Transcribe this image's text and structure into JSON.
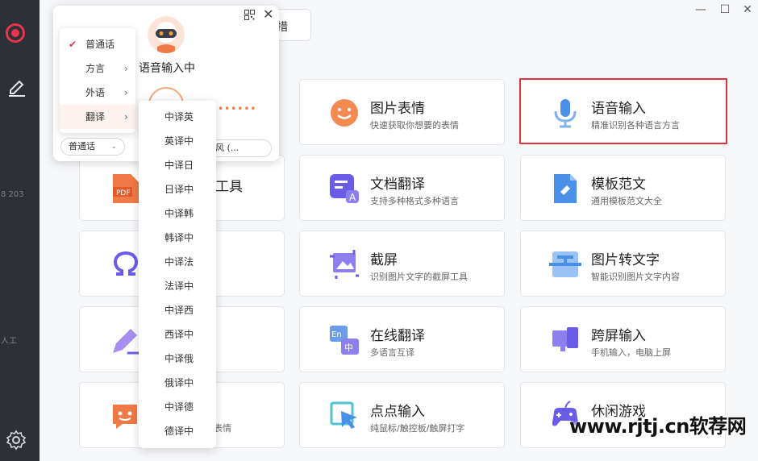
{
  "window": {
    "minimize": "—",
    "maximize": "☐",
    "close": "✕"
  },
  "rail": {
    "fragments": [
      "8 203",
      "人工"
    ]
  },
  "hidden_button": {
    "label": "措"
  },
  "cards": [
    {
      "title": "图片表情",
      "desc": "快速获取你想要的表情",
      "icon": "smile-emoji-icon"
    },
    {
      "title": "语音输入",
      "desc": "精准识别各种语言方言",
      "icon": "microphone-icon"
    },
    {
      "title": "文档翻译",
      "desc": "支持多种格式多种语言",
      "icon": "document-translate-icon"
    },
    {
      "title": "模板范文",
      "desc": "通用模板范文大全",
      "icon": "template-icon"
    },
    {
      "title": "截屏",
      "desc": "识别图片文字的截屏工具",
      "icon": "screenshot-icon"
    },
    {
      "title": "图片转文字",
      "desc": "智能识别图片文字内容",
      "icon": "image-to-text-icon"
    },
    {
      "title": "在线翻译",
      "desc": "多语言互译",
      "icon": "online-translate-icon"
    },
    {
      "title": "跨屏输入",
      "desc": "手机输入，电脑上屏",
      "icon": "cross-screen-icon"
    },
    {
      "title": "点点输入",
      "desc": "纯鼠标/触控板/触屏打字",
      "icon": "click-input-icon"
    },
    {
      "title": "休闲游戏",
      "desc": "",
      "icon": "game-controller-icon"
    }
  ],
  "left_cards": {
    "pdf_partial_title": "工具",
    "pdf_partial_desc": "",
    "emoji_partial_desc": "表情"
  },
  "voice_popup": {
    "status": "语音输入中",
    "mic_device": "克风 (...",
    "lang_select": "普通话",
    "dots": "••••••"
  },
  "lang_menu": [
    {
      "label": "普通话",
      "checked": true,
      "has_sub": false
    },
    {
      "label": "方言",
      "checked": false,
      "has_sub": true
    },
    {
      "label": "外语",
      "checked": false,
      "has_sub": true
    },
    {
      "label": "翻译",
      "checked": false,
      "has_sub": true
    }
  ],
  "translate_menu": [
    "中译英",
    "英译中",
    "中译日",
    "日译中",
    "中译韩",
    "韩译中",
    "中译法",
    "法译中",
    "中译西",
    "西译中",
    "中译俄",
    "俄译中",
    "中译德",
    "德译中"
  ],
  "watermark": "www.rjtj.cn软荐网",
  "colors": {
    "accent": "#e8354d",
    "orange": "#f07a45",
    "blue": "#4a8fe8",
    "purple": "#6b5ce7"
  }
}
